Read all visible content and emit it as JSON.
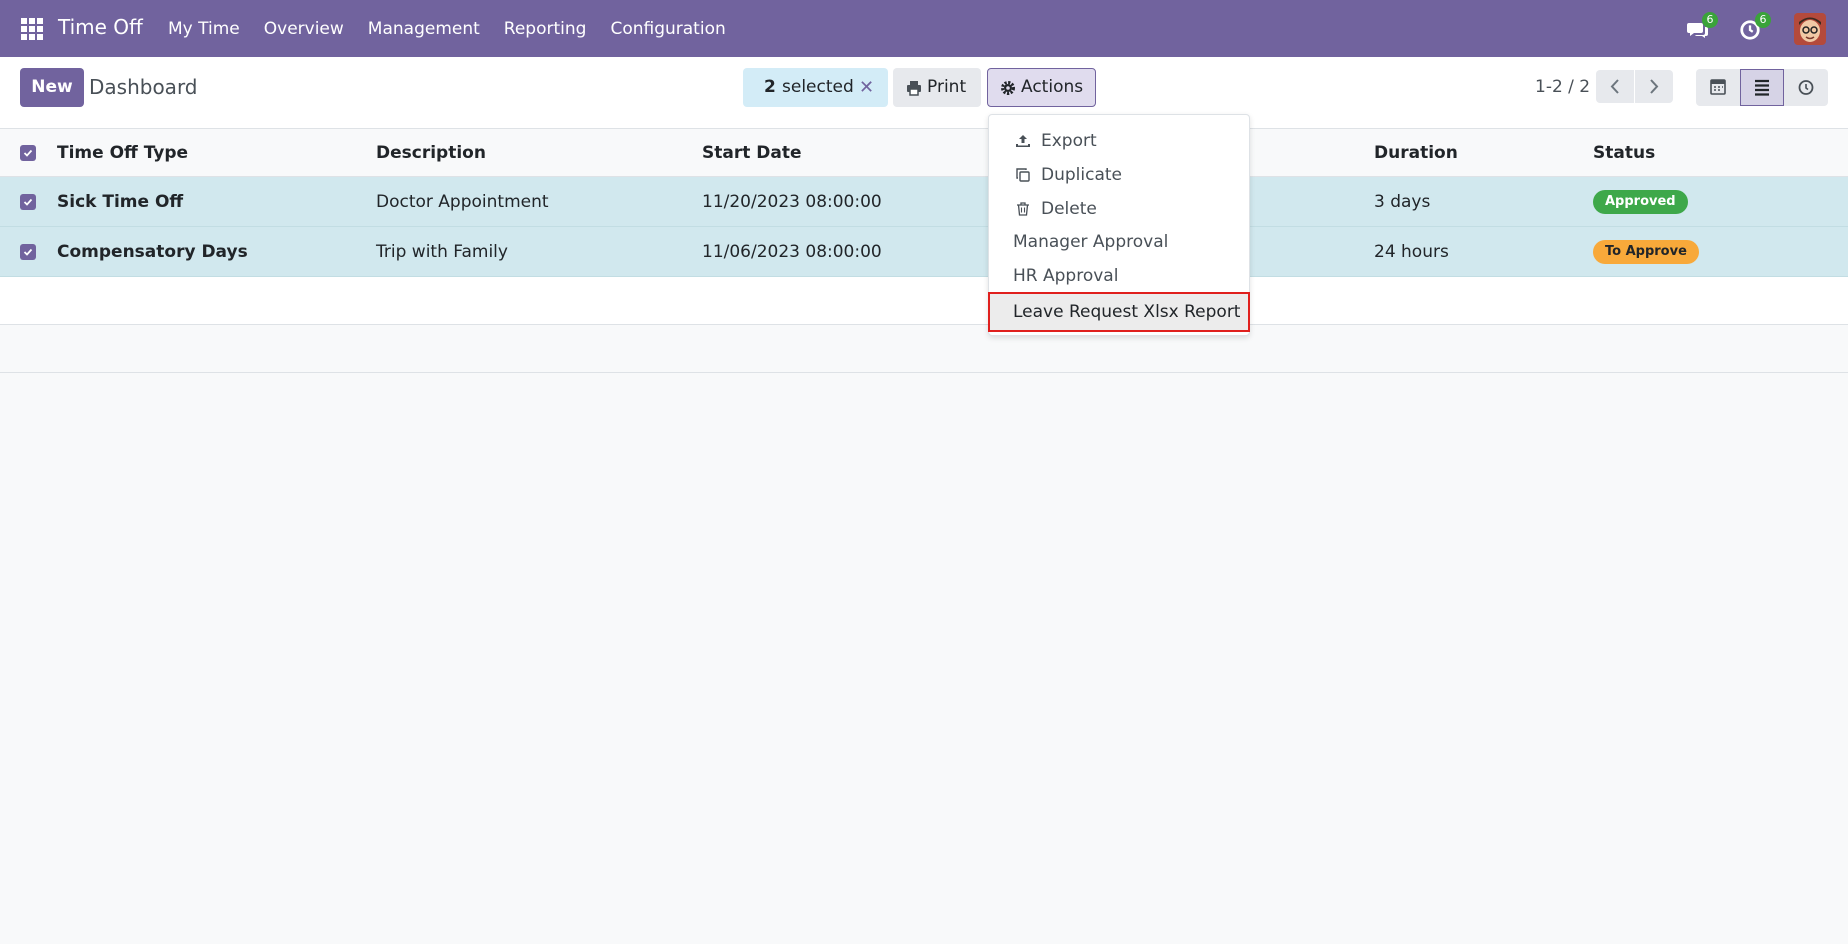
{
  "navbar": {
    "app_name": "Time Off",
    "menu": [
      "My Time",
      "Overview",
      "Management",
      "Reporting",
      "Configuration"
    ],
    "messages_count": "6",
    "activities_count": "6",
    "bg_color": "#71639e"
  },
  "control_panel": {
    "new_label": "New",
    "breadcrumb": "Dashboard",
    "selected_count": "2",
    "selected_label": "selected",
    "print_label": "Print",
    "actions_label": "Actions",
    "pager_value": "1-2 / 2"
  },
  "actions_menu": {
    "items": [
      {
        "label": "Export",
        "icon": "upload-icon"
      },
      {
        "label": "Duplicate",
        "icon": "copy-icon"
      },
      {
        "label": "Delete",
        "icon": "trash-icon"
      },
      {
        "label": "Manager Approval"
      },
      {
        "label": "HR Approval"
      },
      {
        "label": "Leave Request Xlsx Report",
        "highlighted": true
      }
    ]
  },
  "list": {
    "columns": [
      "Time Off Type",
      "Description",
      "Start Date",
      "Duration",
      "Status"
    ],
    "rows": [
      {
        "type": "Sick Time Off",
        "description": "Doctor Appointment",
        "start_date": "11/20/2023 08:00:00",
        "duration": "3 days",
        "status": "Approved"
      },
      {
        "type": "Compensatory Days",
        "description": "Trip with Family",
        "start_date": "11/06/2023 08:00:00",
        "duration": "24 hours",
        "status": "To Approve"
      }
    ]
  },
  "colors": {
    "approved": "#3ea84a",
    "to_approve": "#f8a93a",
    "selected_row": "#d1e8ee",
    "highlight_border": "#e0201e"
  }
}
